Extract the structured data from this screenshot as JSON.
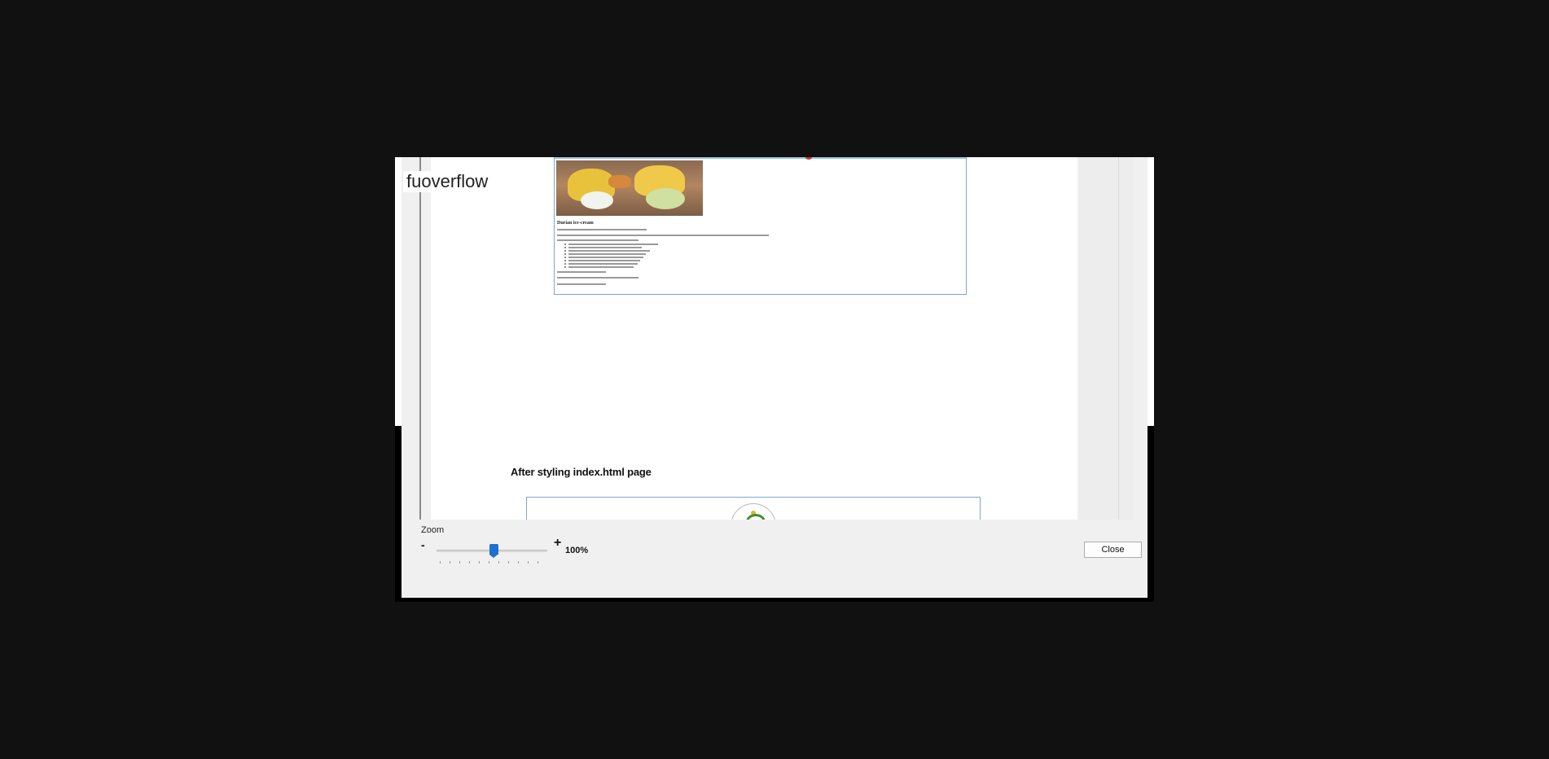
{
  "overlay_text": "fuoverflow",
  "document": {
    "section_heading": "After styling index.html page",
    "screenshot_title": "Durian ice-cream"
  },
  "zoom": {
    "label": "Zoom",
    "minus": "-",
    "plus": "+",
    "value_text": "100%",
    "slider_level": 0.52
  },
  "buttons": {
    "close": "Close"
  },
  "colors": {
    "backdrop": "#111111",
    "dialog_bg": "#f0f0f0",
    "slider_accent": "#1e6fd0",
    "screenshot_border": "#7aa7d6"
  }
}
